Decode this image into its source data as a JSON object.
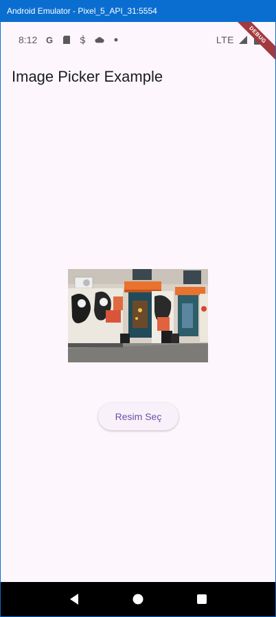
{
  "window": {
    "title": "Android Emulator - Pixel_5_API_31:5554"
  },
  "status_bar": {
    "time": "8:12",
    "network": "LTE",
    "icons_left": [
      "google-icon",
      "sim-card-icon",
      "storage-icon",
      "cloud-icon",
      "dot-icon"
    ],
    "icons_right": [
      "signal-icon",
      "battery-icon"
    ]
  },
  "debug_banner": {
    "label": "DEBUG",
    "color": "#a33a3f"
  },
  "app_bar": {
    "title": "Image Picker Example"
  },
  "main": {
    "image": {
      "semantic": "picked-image",
      "description_icon": "storefront-photo"
    },
    "pick_button": {
      "label": "Resim Seç"
    }
  },
  "nav_bar": {
    "buttons": [
      "back-icon",
      "home-icon",
      "recents-icon"
    ]
  },
  "colors": {
    "accent": "#6750a4",
    "background": "#fdf7fd",
    "window_title": "#0a6ed1"
  }
}
